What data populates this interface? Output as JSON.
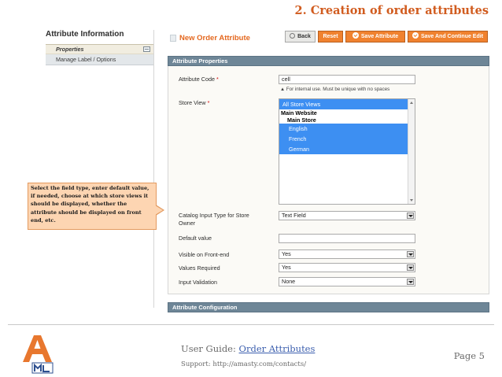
{
  "doc": {
    "title": "2. Creation of order attributes"
  },
  "sidebar": {
    "title": "Attribute Information",
    "items": [
      {
        "label": "Properties"
      },
      {
        "label": "Manage Label / Options"
      }
    ]
  },
  "form": {
    "title": "New Order Attribute",
    "buttons": {
      "back": "Back",
      "reset": "Reset",
      "save": "Save Attribute",
      "save_continue": "Save And Continue Edit"
    },
    "section_properties": "Attribute Properties",
    "section_config": "Attribute Configuration",
    "fields": {
      "attribute_code": {
        "label": "Attribute Code",
        "required": "*",
        "value": "cell",
        "note": "For internal use. Must be unique with no spaces"
      },
      "store_view": {
        "label": "Store View",
        "required": "*",
        "options": {
          "all": "All Store Views",
          "website": "Main Website",
          "store": "Main Store",
          "views": [
            "English",
            "French",
            "German"
          ]
        }
      },
      "input_type": {
        "label": "Catalog Input Type for Store Owner",
        "value": "Text Field"
      },
      "default_value": {
        "label": "Default value",
        "value": ""
      },
      "visible_front": {
        "label": "Visible on Front-end",
        "value": "Yes"
      },
      "values_required": {
        "label": "Values Required",
        "value": "Yes"
      },
      "input_validation": {
        "label": "Input Validation",
        "value": "None"
      }
    }
  },
  "callout": {
    "text": "Select the field type, enter default value, if needed, choose at which store views it should be displayed, whether the attribute should be displayed on front end, etc."
  },
  "footer": {
    "guide_prefix": "User Guide: ",
    "guide_link": "Order Attributes",
    "support": "Support: http://amasty.com/contacts/",
    "page": "Page 5"
  },
  "colors": {
    "accent": "#d15c1f",
    "button": "#f0822f",
    "section_header": "#6e8697",
    "selection": "#3d8ff2",
    "callout": "#fdd5b2"
  },
  "icons": {
    "logo": "amasty-logo",
    "toggle": "collapse-icon",
    "back": "back-arrow-icon",
    "check": "check-circle-icon"
  }
}
